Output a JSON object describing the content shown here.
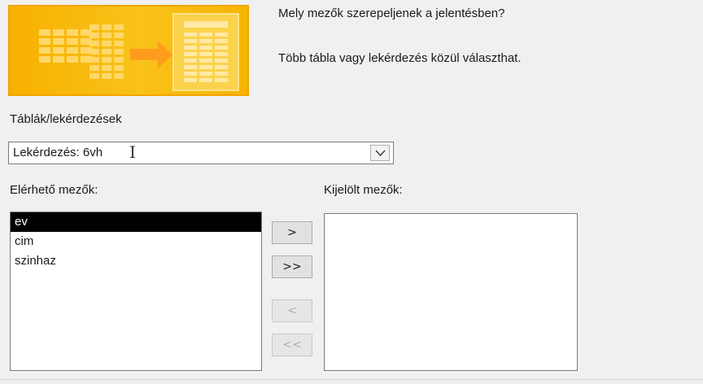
{
  "header": {
    "question": "Mely mezők szerepeljenek a jelentésben?",
    "hint": "Több tábla vagy lekérdezés közül választhat."
  },
  "tables": {
    "label": "Táblák/lekérdezések",
    "selected_value": "Lekérdezés: 6vh"
  },
  "available_fields": {
    "label": "Elérhető mezők:",
    "items": [
      "ev",
      "cim",
      "szinhaz"
    ],
    "selected_index": 0
  },
  "selected_fields": {
    "label": "Kijelölt mezők:",
    "items": []
  },
  "buttons": {
    "add_one": ">",
    "add_all": ">>",
    "remove_one": "<",
    "remove_all": "<<"
  },
  "icons": {
    "banner": "report-wizard-illustration",
    "combo_arrow": "chevron-down-icon",
    "cursor": "text-cursor-icon"
  },
  "colors": {
    "banner_orange": "#f7b100",
    "selection": "#000000"
  }
}
